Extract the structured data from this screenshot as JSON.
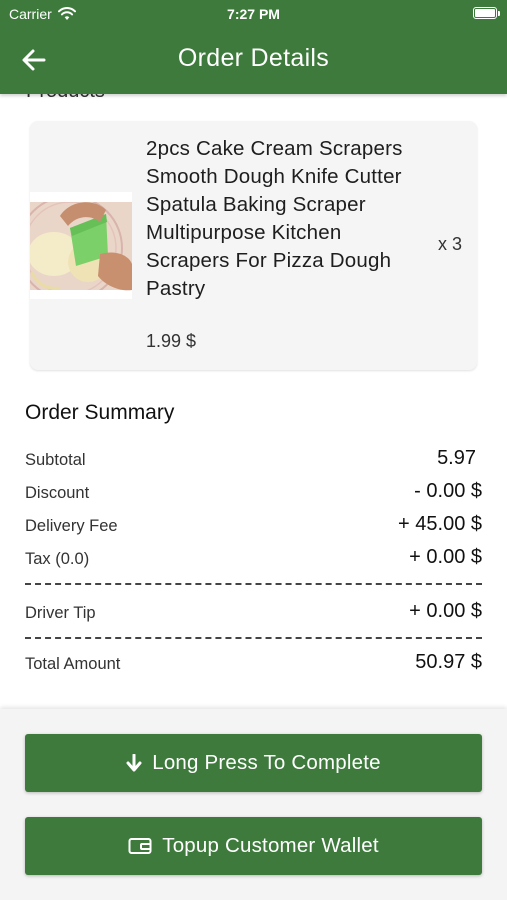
{
  "status_bar": {
    "carrier": "Carrier",
    "time": "7:27 PM"
  },
  "header": {
    "title": "Order Details"
  },
  "products": {
    "heading": "Products",
    "items": [
      {
        "name": "2pcs Cake Cream Scrapers Smooth Dough Knife Cutter Spatula Baking Scraper Multipurpose Kitchen Scrapers For Pizza Dough Pastry",
        "price": "1.99 $",
        "quantity": "x 3"
      }
    ]
  },
  "summary": {
    "title": "Order Summary",
    "subtotal_label": "Subtotal",
    "subtotal_value": "5.97",
    "discount_label": "Discount",
    "discount_value": "- 0.00 $",
    "delivery_label": "Delivery Fee",
    "delivery_value": "+ 45.00 $",
    "tax_label": "Tax (0.0)",
    "tax_value": "+ 0.00 $",
    "tip_label": "Driver Tip",
    "tip_value": "+ 0.00 $",
    "total_label": "Total Amount",
    "total_value": "50.97 $"
  },
  "actions": {
    "complete_label": "Long Press To Complete",
    "complete_icon": "arrow-down-icon",
    "wallet_label": "Topup Customer Wallet",
    "wallet_icon": "wallet-icon"
  },
  "colors": {
    "primary": "#3d7a3c",
    "card_background": "#f5f5f5",
    "bottom_panel": "#f4f4f4"
  }
}
